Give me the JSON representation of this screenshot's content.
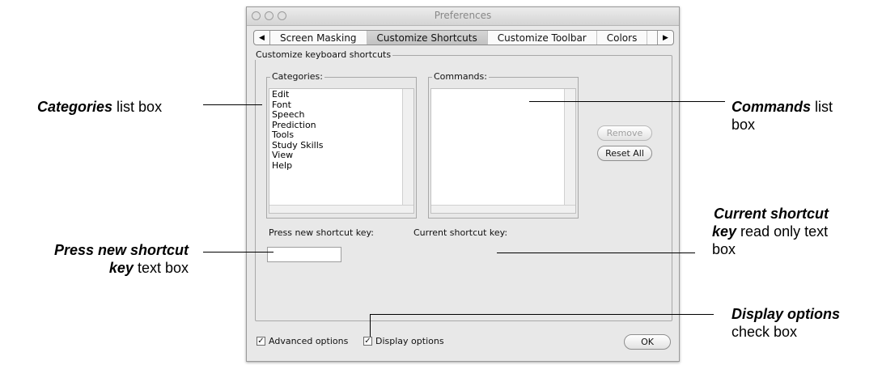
{
  "window": {
    "title": "Preferences",
    "tabs": [
      {
        "label": "Screen Masking"
      },
      {
        "label": "Customize Shortcuts",
        "active": true
      },
      {
        "label": "Customize Toolbar"
      },
      {
        "label": "Colors"
      }
    ]
  },
  "group": {
    "title": "Customize keyboard shortcuts",
    "categories_label": "Categories:",
    "commands_label": "Commands:",
    "categories": [
      "Edit",
      "Font",
      "Speech",
      "Prediction",
      "Tools",
      "Study Skills",
      "View",
      "Help"
    ],
    "remove_label": "Remove",
    "reset_all_label": "Reset All",
    "press_new_label": "Press new shortcut key:",
    "current_label": "Current shortcut key:",
    "new_shortcut_value": ""
  },
  "footer": {
    "advanced_label": "Advanced options",
    "advanced_checked": true,
    "display_label": "Display options",
    "display_checked": true,
    "ok_label": "OK"
  },
  "annotations": {
    "categories_bold": "Categories",
    "categories_rest": " list box",
    "commands_bold": "Commands",
    "commands_rest_1": " list",
    "commands_rest_2": "box",
    "press_bold_1": "Press new shortcut",
    "press_bold_2": "key",
    "press_rest": " text box",
    "current_bold_1": "Current shortcut",
    "current_bold_2": "key",
    "current_rest_1": " read only text",
    "current_rest_2": "box",
    "display_bold": "Display options",
    "display_rest": "check box"
  }
}
